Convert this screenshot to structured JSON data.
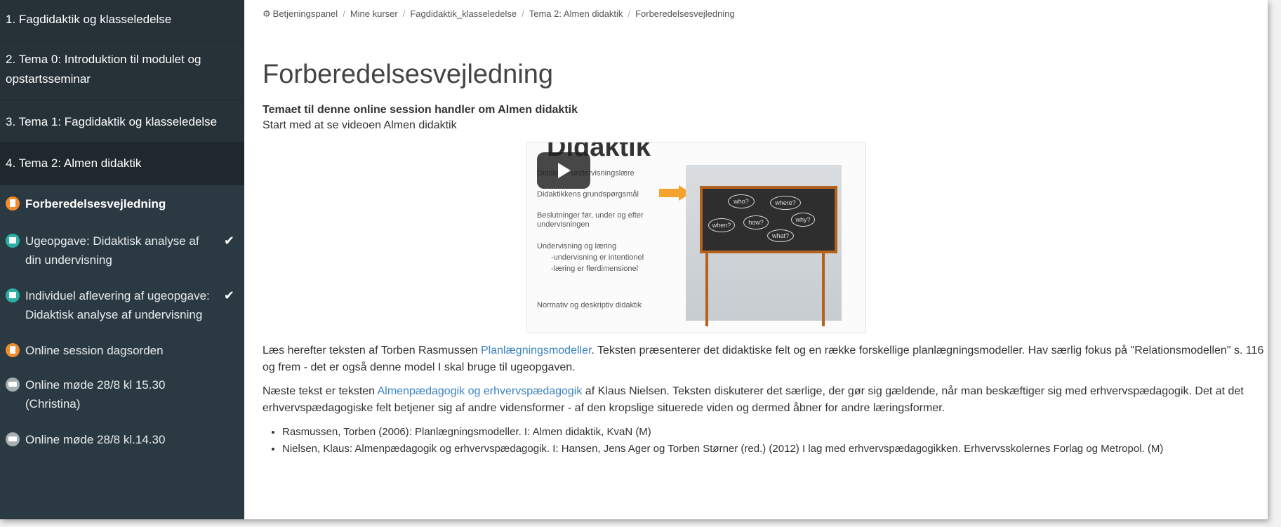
{
  "sidebar": {
    "sections": [
      {
        "label": "1. Fagdidaktik og klasseledelse"
      },
      {
        "label": "2. Tema 0: Introduktion til modulet og opstartsseminar"
      },
      {
        "label": "3. Tema 1: Fagdidaktik og klasseledelse"
      },
      {
        "label": "4. Tema 2: Almen didaktik"
      }
    ],
    "items": [
      {
        "label": "Forberedelsesvejledning",
        "icon": "page-icon"
      },
      {
        "label": "Ugeopgave: Didaktisk analyse af din undervisning",
        "icon": "assignment-icon",
        "completed": true
      },
      {
        "label": "Individuel aflevering af ugeopgave: Didaktisk analyse af undervisning",
        "icon": "assignment-icon",
        "completed": true
      },
      {
        "label": "Online session dagsorden",
        "icon": "page-icon"
      },
      {
        "label": "Online møde 28/8 kl 15.30 (Christina)",
        "icon": "meeting-icon"
      },
      {
        "label": "Online møde 28/8 kl.14.30",
        "icon": "meeting-icon"
      }
    ],
    "check_glyph": "✔"
  },
  "breadcrumb": [
    "Betjeningspanel",
    "Mine kurser",
    "Fagdidaktik_klasseledelse",
    "Tema 2: Almen didaktik",
    "Forberedelsesvejledning"
  ],
  "page": {
    "title": "Forberedelsesvejledning",
    "lead_bold": "Temaet til denne online session handler om Almen didaktik",
    "lead": "Start med at se videoen Almen didaktik"
  },
  "video": {
    "heading": "Didaktik",
    "lines": [
      "Didaktik - undervisningslære",
      "Didaktikkens grundspørgsmål",
      "Beslutninger før, under og efter undervisningen",
      "Undervisning og læring",
      "-undervisning er intentionel",
      "-læring er flerdimensionel",
      "Normativ og deskriptiv didaktik"
    ],
    "bubbles": [
      "who?",
      "where?",
      "when?",
      "how?",
      "why?",
      "what?"
    ]
  },
  "paragraphs": {
    "p1_before": "Læs herefter teksten af Torben Rasmussen ",
    "p1_link": "Planlægningsmodeller",
    "p1_after": ". Teksten præsenterer det didaktiske felt og en række forskellige planlægningsmodeller. Hav særlig fokus på \"Relationsmodellen\" s. 116 og frem - det er også denne model I skal bruge til ugeopgaven.",
    "p2_before": "Næste tekst er teksten ",
    "p2_link": "Almenpædagogik og erhvervspædagogik",
    "p2_after": " af Klaus Nielsen. Teksten diskuterer det særlige, der gør sig gældende, når man beskæftiger sig med erhvervspædagogik. Det at det erhvervspædagogiske felt betjener sig af andre vidensformer -  af den kropslige situerede viden og dermed åbner for andre læringsformer."
  },
  "references": [
    "Rasmussen, Torben (2006): Planlægningsmodeller. I: Almen didaktik, KvaN (M)",
    "Nielsen, Klaus: Almenpædagogik og erhvervspædagogik. I: Hansen, Jens Ager og Torben Størner (red.) (2012) I lag med erhvervspædagogikken. Erhvervsskolernes Forlag og Metropol. (M)"
  ]
}
